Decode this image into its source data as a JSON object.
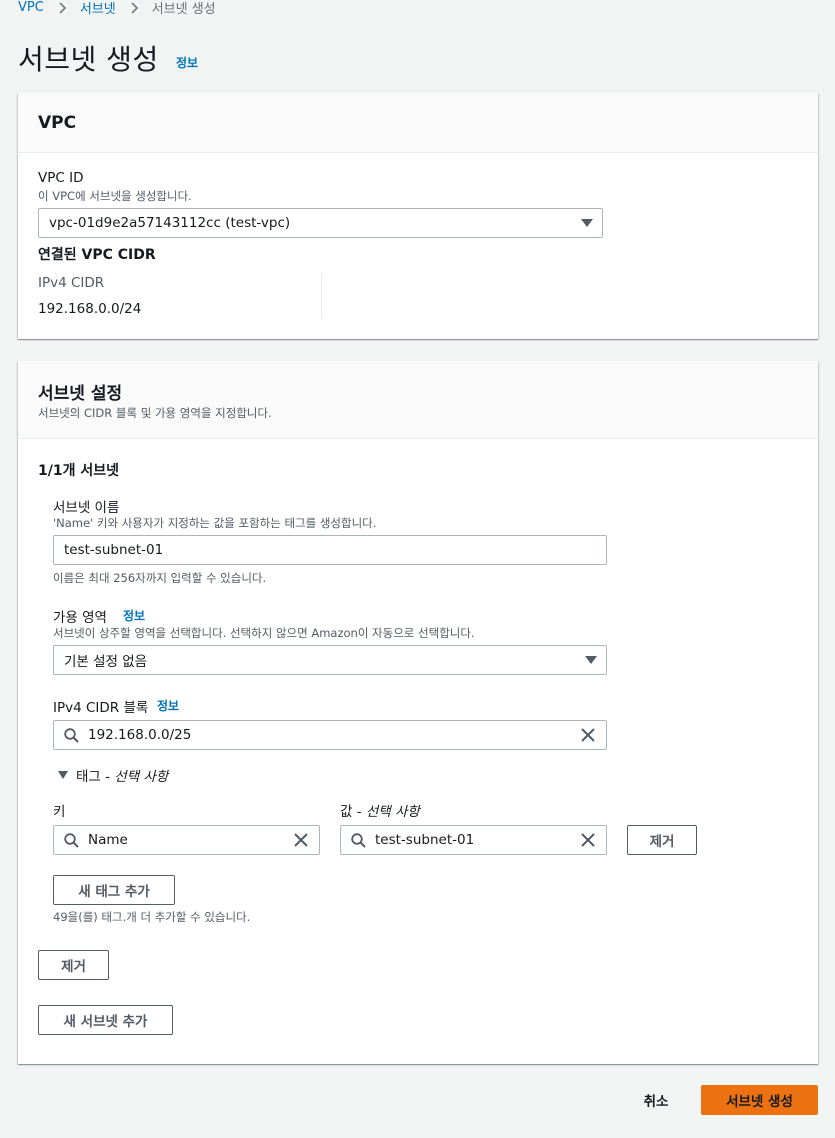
{
  "breadcrumb": {
    "items": [
      "VPC",
      "서브넷",
      "서브넷 생성"
    ]
  },
  "page": {
    "title": "서브넷 생성",
    "info": "정보"
  },
  "vpc_panel": {
    "heading": "VPC",
    "vpc_id_label": "VPC ID",
    "vpc_id_desc": "이 VPC에 서브넷을 생성합니다.",
    "vpc_id_value": "vpc-01d9e2a57143112cc (test-vpc)",
    "cidr_heading": "연결된 VPC CIDR",
    "ipv4_cidr_label": "IPv4 CIDR",
    "ipv4_cidr_value": "192.168.0.0/24"
  },
  "subnet_panel": {
    "heading": "서브넷 설정",
    "desc": "서브넷의 CIDR 블록 및 가용 영역을 지정합니다.",
    "count_heading": "1/1개 서브넷",
    "name_label": "서브넷 이름",
    "name_desc": "'Name' 키와 사용자가 지정하는 값을 포함하는 태그를 생성합니다.",
    "name_value": "test-subnet-01",
    "name_hint": "이름은 최대 256자까지 입력할 수 있습니다.",
    "az_label": "가용 영역",
    "az_info": "정보",
    "az_desc": "서브넷이 상주할 영역을 선택합니다. 선택하지 않으면 Amazon이 자동으로 선택합니다.",
    "az_value": "기본 설정 없음",
    "cidr_label": "IPv4 CIDR 블록",
    "cidr_info": "정보",
    "cidr_value": "192.168.0.0/25",
    "tags_toggle": "태그 - ",
    "tags_toggle_optional": "선택 사항",
    "key_label": "키",
    "value_label": "값 - ",
    "value_label_optional": "선택 사항",
    "tag_key": "Name",
    "tag_value": "test-subnet-01",
    "remove_tag_button": "제거",
    "add_tag_button": "새 태그 추가",
    "tag_limit_hint": "49을(를) 태그.개 더 추가할 수 있습니다.",
    "remove_subnet_button": "제거",
    "add_subnet_button": "새 서브넷 추가"
  },
  "footer": {
    "cancel_button": "취소",
    "create_button": "서브넷 생성"
  },
  "colors": {
    "link": "#0073bb",
    "primary": "#ec7211",
    "text": "#16191f",
    "muted": "#545b64",
    "background": "#f2f3f3"
  },
  "icons": {
    "breadcrumb_separator": "chevron-right-icon",
    "select_caret": "caret-down-icon",
    "search": "search-icon",
    "clear": "close-icon",
    "expand": "caret-down-icon"
  }
}
